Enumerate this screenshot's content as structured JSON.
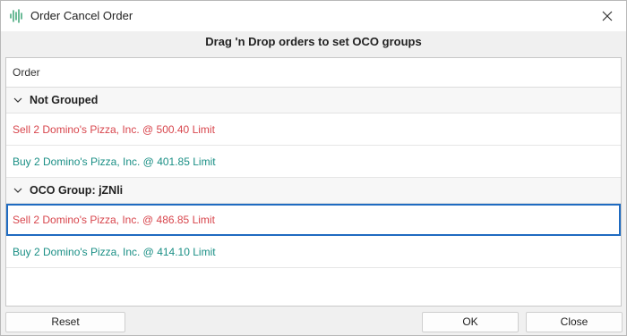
{
  "window": {
    "title": "Order Cancel Order"
  },
  "instruction": "Drag 'n Drop orders to set OCO groups",
  "grid": {
    "column_header": "Order",
    "groups": [
      {
        "name": "Not Grouped",
        "orders": [
          {
            "text": "Sell 2 Domino's Pizza, Inc. @ 500.40 Limit",
            "side": "sell"
          },
          {
            "text": "Buy 2 Domino's Pizza, Inc. @ 401.85 Limit",
            "side": "buy"
          }
        ]
      },
      {
        "name": "OCO Group: jZNli",
        "orders": [
          {
            "text": "Sell 2 Domino's Pizza, Inc. @ 486.85 Limit",
            "side": "sell",
            "selected": true
          },
          {
            "text": "Buy 2 Domino's Pizza, Inc. @ 414.10 Limit",
            "side": "buy"
          }
        ]
      }
    ]
  },
  "buttons": {
    "reset": "Reset",
    "ok": "OK",
    "close": "Close"
  },
  "colors": {
    "sell": "#d8464d",
    "buy": "#1a8f85",
    "selection": "#1f6bc1"
  },
  "icons": {
    "app": "waveform-icon",
    "close": "close-icon",
    "expand": "chevron-down-icon"
  }
}
